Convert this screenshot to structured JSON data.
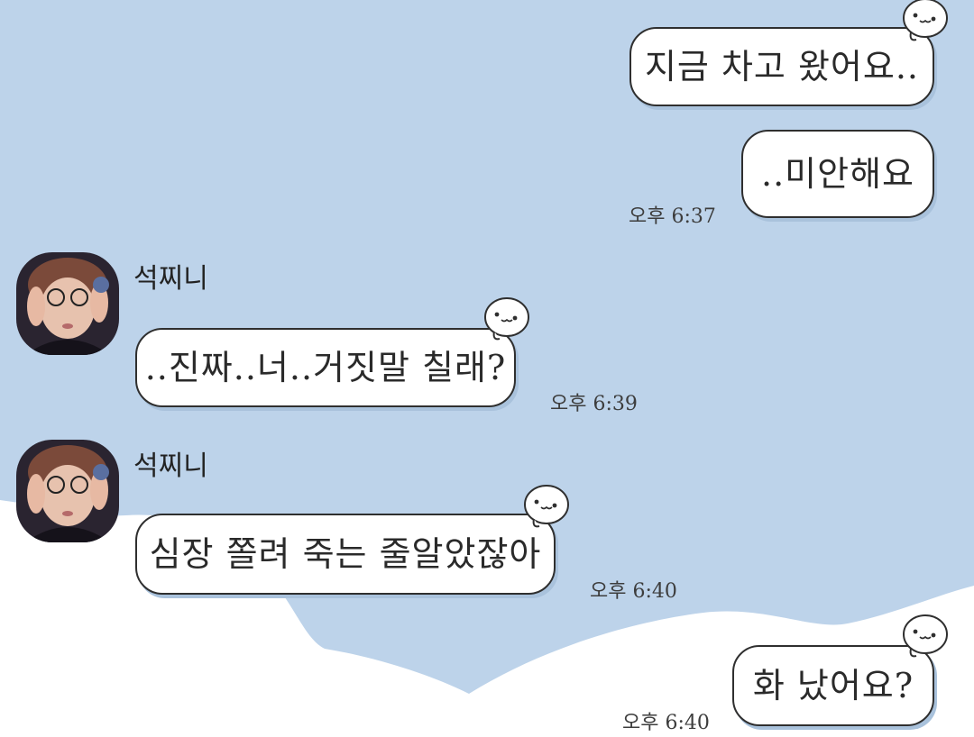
{
  "messages": [
    {
      "id": "m1",
      "side": "right",
      "text": "지금 차고 왔어요..",
      "time": ""
    },
    {
      "id": "m2",
      "side": "right",
      "text": "..미안해요",
      "time": "오후 6:37"
    },
    {
      "id": "m3",
      "side": "left",
      "sender": "석찌니",
      "text": "..진짜..너..거짓말 칠래?",
      "time": "오후 6:39"
    },
    {
      "id": "m4",
      "side": "left",
      "sender": "석찌니",
      "text": "심장 쫄려 죽는 줄알았잖아",
      "time": "오후 6:40"
    },
    {
      "id": "m5",
      "side": "right",
      "text": "화 났어요?",
      "time": "오후 6:40"
    }
  ],
  "colors": {
    "background_sky": "#bdd3ea",
    "background_cloud": "#ffffff",
    "bubble_fill": "#ffffff",
    "bubble_border": "#2f2f2f"
  },
  "icons": [
    "mascot-face-icon",
    "avatar-photo"
  ]
}
